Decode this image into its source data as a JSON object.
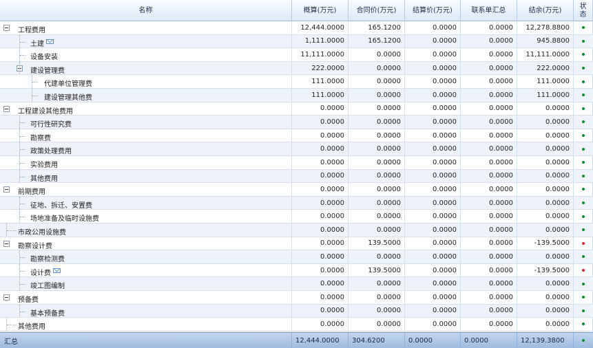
{
  "headers": {
    "name": "名称",
    "budget": "概算(万元)",
    "contract": "合同价(万元)",
    "settlement": "结算价(万元)",
    "liaison": "联系单汇总",
    "balance": "结余(万元)",
    "status": "状\n态"
  },
  "rows": [
    {
      "name": "工程费用",
      "level": 0,
      "expand": true,
      "mail": false,
      "budget": "12,444.0000",
      "contract": "165.1200",
      "settlement": "0.0000",
      "liaison": "0.0000",
      "balance": "12,278.8800",
      "status": "green"
    },
    {
      "name": "土建",
      "level": 1,
      "expand": false,
      "mail": true,
      "budget": "1,111.0000",
      "contract": "165.1200",
      "settlement": "0.0000",
      "liaison": "0.0000",
      "balance": "945.8800",
      "status": "green"
    },
    {
      "name": "设备安装",
      "level": 1,
      "expand": false,
      "mail": false,
      "budget": "11,111.0000",
      "contract": "0.0000",
      "settlement": "0.0000",
      "liaison": "0.0000",
      "balance": "11,111.0000",
      "status": "green"
    },
    {
      "name": "建设管理费",
      "level": 1,
      "expand": true,
      "mail": false,
      "budget": "222.0000",
      "contract": "0.0000",
      "settlement": "0.0000",
      "liaison": "0.0000",
      "balance": "222.0000",
      "status": "green"
    },
    {
      "name": "代建单位管理费",
      "level": 2,
      "expand": false,
      "mail": false,
      "budget": "111.0000",
      "contract": "0.0000",
      "settlement": "0.0000",
      "liaison": "0.0000",
      "balance": "111.0000",
      "status": "green"
    },
    {
      "name": "建设管理其他费",
      "level": 2,
      "expand": false,
      "mail": false,
      "budget": "111.0000",
      "contract": "0.0000",
      "settlement": "0.0000",
      "liaison": "0.0000",
      "balance": "111.0000",
      "status": "green"
    },
    {
      "name": "工程建设其他费用",
      "level": 0,
      "expand": true,
      "mail": false,
      "budget": "0.0000",
      "contract": "0.0000",
      "settlement": "0.0000",
      "liaison": "0.0000",
      "balance": "0.0000",
      "status": "green"
    },
    {
      "name": "可行性研究费",
      "level": 1,
      "expand": false,
      "mail": false,
      "budget": "0.0000",
      "contract": "0.0000",
      "settlement": "0.0000",
      "liaison": "0.0000",
      "balance": "0.0000",
      "status": "green"
    },
    {
      "name": "勘察费",
      "level": 1,
      "expand": false,
      "mail": false,
      "budget": "0.0000",
      "contract": "0.0000",
      "settlement": "0.0000",
      "liaison": "0.0000",
      "balance": "0.0000",
      "status": "green"
    },
    {
      "name": "政策处理费用",
      "level": 1,
      "expand": false,
      "mail": false,
      "budget": "0.0000",
      "contract": "0.0000",
      "settlement": "0.0000",
      "liaison": "0.0000",
      "balance": "0.0000",
      "status": "green"
    },
    {
      "name": "实验费用",
      "level": 1,
      "expand": false,
      "mail": false,
      "budget": "0.0000",
      "contract": "0.0000",
      "settlement": "0.0000",
      "liaison": "0.0000",
      "balance": "0.0000",
      "status": "green"
    },
    {
      "name": "其他费用",
      "level": 1,
      "expand": false,
      "mail": false,
      "budget": "0.0000",
      "contract": "0.0000",
      "settlement": "0.0000",
      "liaison": "0.0000",
      "balance": "0.0000",
      "status": "green"
    },
    {
      "name": "前期费用",
      "level": 0,
      "expand": true,
      "mail": false,
      "budget": "0.0000",
      "contract": "0.0000",
      "settlement": "0.0000",
      "liaison": "0.0000",
      "balance": "0.0000",
      "status": "green"
    },
    {
      "name": "征地、拆迁、安置费",
      "level": 1,
      "expand": false,
      "mail": false,
      "budget": "0.0000",
      "contract": "0.0000",
      "settlement": "0.0000",
      "liaison": "0.0000",
      "balance": "0.0000",
      "status": "green"
    },
    {
      "name": "场地准备及临时设施费",
      "level": 1,
      "expand": false,
      "mail": false,
      "budget": "0.0000",
      "contract": "0.0000",
      "settlement": "0.0000",
      "liaison": "0.0000",
      "balance": "0.0000",
      "status": "green"
    },
    {
      "name": "市政公用设施费",
      "level": 0,
      "expand": false,
      "mail": false,
      "budget": "0.0000",
      "contract": "0.0000",
      "settlement": "0.0000",
      "liaison": "0.0000",
      "balance": "0.0000",
      "status": "green"
    },
    {
      "name": "勘察设计费",
      "level": 0,
      "expand": true,
      "mail": false,
      "budget": "0.0000",
      "contract": "139.5000",
      "settlement": "0.0000",
      "liaison": "0.0000",
      "balance": "-139.5000",
      "status": "red"
    },
    {
      "name": "勘察检测费",
      "level": 1,
      "expand": false,
      "mail": false,
      "budget": "0.0000",
      "contract": "0.0000",
      "settlement": "0.0000",
      "liaison": "0.0000",
      "balance": "0.0000",
      "status": "green"
    },
    {
      "name": "设计费",
      "level": 1,
      "expand": false,
      "mail": true,
      "budget": "0.0000",
      "contract": "139.5000",
      "settlement": "0.0000",
      "liaison": "0.0000",
      "balance": "-139.5000",
      "status": "red"
    },
    {
      "name": "竣工图编制",
      "level": 1,
      "expand": false,
      "mail": false,
      "budget": "0.0000",
      "contract": "0.0000",
      "settlement": "0.0000",
      "liaison": "0.0000",
      "balance": "0.0000",
      "status": "green"
    },
    {
      "name": "预备费",
      "level": 0,
      "expand": true,
      "mail": false,
      "budget": "0.0000",
      "contract": "0.0000",
      "settlement": "0.0000",
      "liaison": "0.0000",
      "balance": "0.0000",
      "status": "green"
    },
    {
      "name": "基本预备费",
      "level": 1,
      "expand": false,
      "mail": false,
      "budget": "0.0000",
      "contract": "0.0000",
      "settlement": "0.0000",
      "liaison": "0.0000",
      "balance": "0.0000",
      "status": "green"
    },
    {
      "name": "其他费用",
      "level": 0,
      "expand": false,
      "mail": false,
      "budget": "0.0000",
      "contract": "0.0000",
      "settlement": "0.0000",
      "liaison": "0.0000",
      "balance": "0.0000",
      "status": "green"
    }
  ],
  "footer": {
    "label": "汇总",
    "budget": "12,444.0000",
    "contract": "304.6200",
    "settlement": "0.0000",
    "liaison": "0.0000",
    "balance": "12,139.3800",
    "status": "green"
  }
}
